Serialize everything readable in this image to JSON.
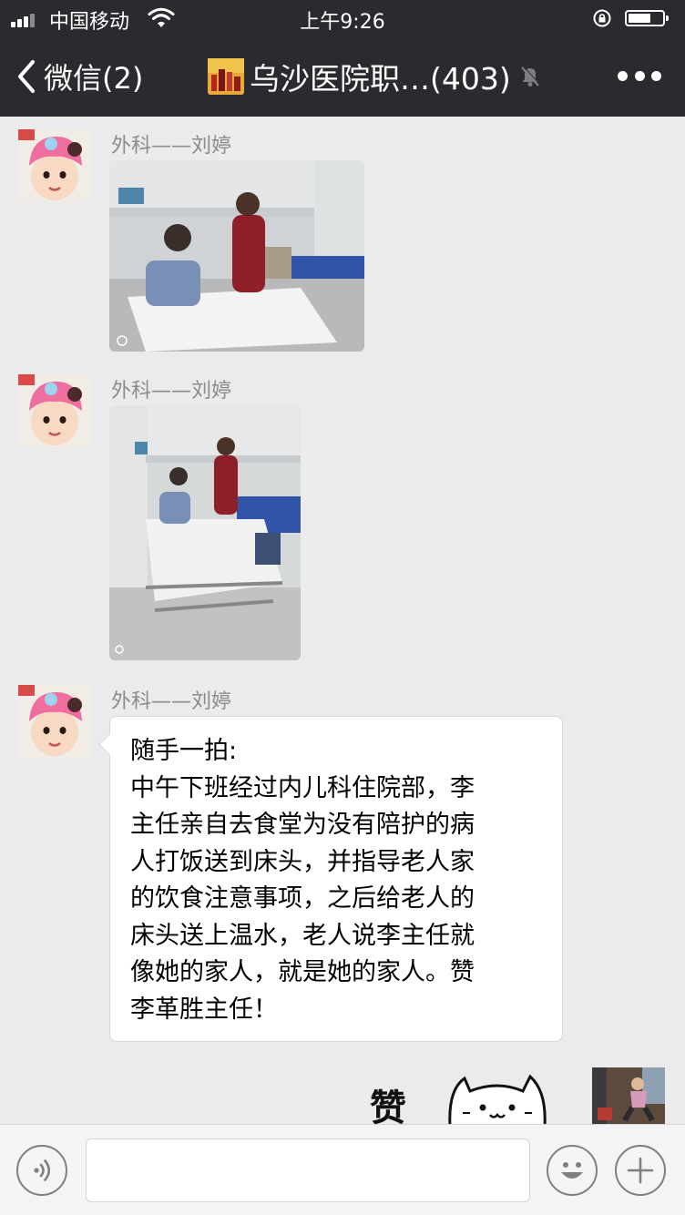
{
  "status_bar": {
    "carrier": "中国移动",
    "time": "上午9:26",
    "icons": [
      "signal-icon",
      "wifi-icon",
      "rotation-lock-icon",
      "battery-icon"
    ]
  },
  "nav": {
    "back_label": "微信(2)",
    "title": "乌沙医院职…(403)",
    "icons": [
      "chevron-left-icon",
      "group-avatar-icon",
      "mute-icon",
      "more-icon"
    ]
  },
  "messages": [
    {
      "sender": "外科——刘婷",
      "type": "image"
    },
    {
      "sender": "外科——刘婷",
      "type": "image"
    },
    {
      "sender": "外科——刘婷",
      "type": "text",
      "lines": [
        "随手一拍:",
        "中午下班经过内儿科住院部，李",
        "主任亲自去食堂为没有陪护的病",
        "人打饭送到床头，并指导老人家",
        "的饮食注意事项，之后给老人的",
        "床头送上温水，老人说李主任就",
        "像她的家人，就是她的家人。赞",
        "李革胜主任！"
      ]
    }
  ],
  "sticker": {
    "text": "赞"
  },
  "input_bar": {
    "placeholder": "",
    "icons": [
      "voice-icon",
      "emoji-icon",
      "plus-icon"
    ]
  },
  "colors": {
    "header_bg": "#2b2b2f",
    "chat_bg": "#ebebeb",
    "bubble_bg": "#ffffff",
    "sender_text": "#8c8c8c"
  }
}
